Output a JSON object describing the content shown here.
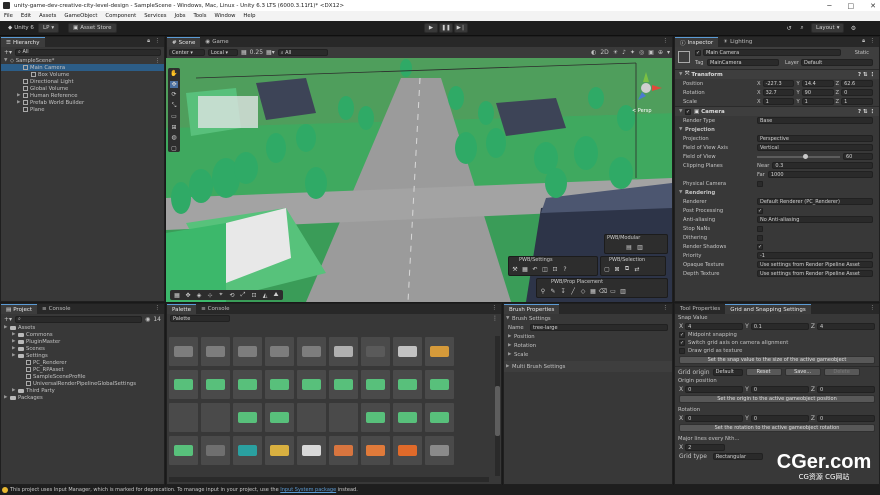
{
  "window": {
    "title": "unity-game-dev-creative-city-level-design - SampleScene - Windows, Mac, Linux - Unity 6.3 LTS (6000.3.11f1)* <DX12>",
    "controls": [
      "─",
      "□",
      "✕"
    ]
  },
  "menu": [
    "File",
    "Edit",
    "Assets",
    "GameObject",
    "Component",
    "Services",
    "Jobs",
    "Tools",
    "Window",
    "Help"
  ],
  "toolbar": {
    "unity": "Unity 6",
    "account": "LP",
    "asset_store": "Asset Store",
    "layout": "Layout"
  },
  "hierarchy": {
    "tab": "Hierarchy",
    "search_placeholder": "All",
    "scene": "SampleScene*",
    "items": [
      "Main Camera",
      "Box Volume",
      "Directional Light",
      "Global Volume",
      "Human Reference",
      "Prefab World Builder",
      "Plane"
    ]
  },
  "scene_view": {
    "tabs": [
      "Scene",
      "Game"
    ],
    "pivot": "Center",
    "space": "Local",
    "snap": "0.25",
    "search_placeholder": "All",
    "persp_label": "< Persp",
    "overlays": {
      "modular": "PWB/Modular",
      "settings": "PWB/Settings",
      "selection": "PWB/Selection",
      "prop": "PWB/Prop Placement"
    }
  },
  "inspector": {
    "tabs": [
      "Inspector",
      "Lighting"
    ],
    "object_name": "Main Camera",
    "static": "Static",
    "tag_label": "Tag",
    "tag": "MainCamera",
    "layer_label": "Layer",
    "layer": "Default",
    "transform": {
      "title": "Transform",
      "position": {
        "label": "Position",
        "x": "-227.3",
        "y": "14.4",
        "z": "62.6"
      },
      "rotation": {
        "label": "Rotation",
        "x": "32.7",
        "y": "90",
        "z": "0"
      },
      "scale": {
        "label": "Scale",
        "x": "1",
        "y": "1",
        "z": "1"
      }
    },
    "camera": {
      "title": "Camera",
      "render_type_label": "Render Type",
      "render_type": "Base",
      "projection_header": "Projection",
      "projection_label": "Projection",
      "projection": "Perspective",
      "fov_axis_label": "Field of View Axis",
      "fov_axis": "Vertical",
      "fov_label": "Field of View",
      "fov": "60",
      "clip_label": "Clipping Planes",
      "near_label": "Near",
      "near": "0.3",
      "far_label": "Far",
      "far": "1000",
      "physical_label": "Physical Camera",
      "rendering_header": "Rendering",
      "renderer_label": "Renderer",
      "renderer": "Default Renderer (PC_Renderer)",
      "post_label": "Post Processing",
      "aa_label": "Anti-aliasing",
      "aa": "No Anti-aliasing",
      "stop_nan_label": "Stop NaNs",
      "dither_label": "Dithering",
      "shadows_label": "Render Shadows",
      "priority_label": "Priority",
      "priority": "-1",
      "opaque_label": "Opaque Texture",
      "opaque": "Use settings from Render Pipeline Asset",
      "depth_label": "Depth Texture",
      "depth": "Use settings from Render Pipeline Asset"
    }
  },
  "project": {
    "tabs": [
      "Project",
      "Console"
    ],
    "count": "14",
    "tree": [
      {
        "label": "Assets",
        "level": 0
      },
      {
        "label": "Commons",
        "level": 1
      },
      {
        "label": "PluginMaster",
        "level": 1
      },
      {
        "label": "Scenes",
        "level": 1
      },
      {
        "label": "Settings",
        "level": 1
      },
      {
        "label": "PC_Renderer",
        "level": 2
      },
      {
        "label": "PC_RPAsset",
        "level": 2
      },
      {
        "label": "SampleSceneProfile",
        "level": 2
      },
      {
        "label": "UniversalRenderPipelineGlobalSettings",
        "level": 2
      },
      {
        "label": "Third Party",
        "level": 1
      },
      {
        "label": "Packages",
        "level": 0
      }
    ]
  },
  "palette": {
    "tabs": [
      "Palette",
      "Console"
    ],
    "sub": "Palette"
  },
  "brush": {
    "tab": "Brush Properties",
    "header": "Brush Settings",
    "name_label": "Name",
    "name": "tree-large",
    "props": [
      "Position",
      "Rotation",
      "Scale"
    ],
    "multi": "Multi Brush Settings"
  },
  "grid": {
    "tabs": [
      "Tool Properties",
      "Grid and Snapping Settings"
    ],
    "snap_value": "Snap Value",
    "snap": {
      "x": "4",
      "y": "0.1",
      "z": "4"
    },
    "midpoint": "Midpoint snapping",
    "switch_axis": "Switch grid axis on camera alignment",
    "draw_texture": "Draw grid as texture",
    "set_snap_btn": "Set the snap value to the size of the active gameobject",
    "origin_label": "Grid origin",
    "origin_value": "Default",
    "reset": "Reset",
    "save": "Save...",
    "delete": "Delete",
    "origin_position": "Origin position",
    "origin": {
      "x": "0",
      "y": "0",
      "z": "0"
    },
    "set_origin_btn": "Set the origin to the active gameobject position",
    "rotation_label": "Rotation",
    "rotation": {
      "x": "0",
      "y": "0",
      "z": "0"
    },
    "set_rotation_btn": "Set the rotation to the active gameobject rotation",
    "major_label": "Major lines every Nth...",
    "major": {
      "x": "2"
    },
    "grid_type_label": "Grid type",
    "grid_type": "Rectangular"
  },
  "status": {
    "message": "This project uses Input Manager, which is marked for deprecation. To manage input in your project, use the",
    "link": "Input System package",
    "suffix": "instead."
  },
  "watermark": "CGer.com",
  "watermark_sub": "CG资源 CG网站",
  "colors": {
    "accent": "#5b9bd5",
    "selection": "#2c5d87",
    "grass": "#3bb56a",
    "road": "#9a9a9a"
  }
}
